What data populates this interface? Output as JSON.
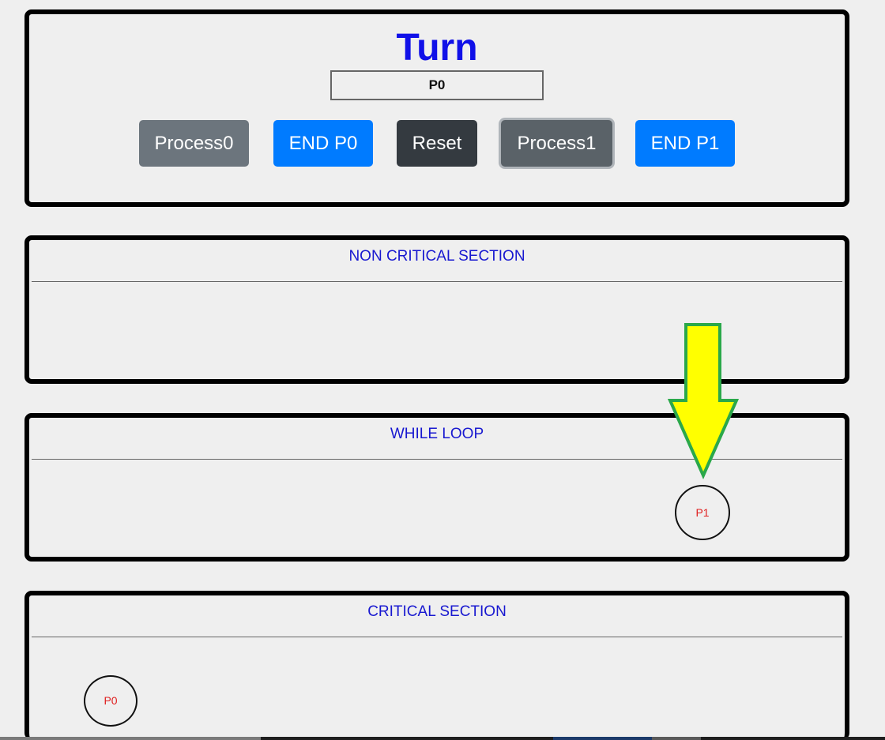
{
  "turn": {
    "title": "Turn",
    "value": "P0"
  },
  "buttons": {
    "process0": "Process0",
    "end_p0": "END P0",
    "reset": "Reset",
    "process1": "Process1",
    "end_p1": "END P1"
  },
  "sections": {
    "non_critical": "NON CRITICAL SECTION",
    "while_loop": "WHILE LOOP",
    "critical": "CRITICAL SECTION"
  },
  "processes": {
    "p1": "P1",
    "p0": "P0"
  },
  "colors": {
    "title_blue": "#1010e8",
    "section_title_blue": "#1818d0",
    "primary_button": "#007bff",
    "secondary_button": "#6c757d",
    "dark_button": "#343a40",
    "process_label": "#e02020",
    "arrow_fill": "#ffff00",
    "arrow_stroke": "#2aa84a"
  },
  "icons": {
    "arrow": "down-arrow-icon"
  }
}
